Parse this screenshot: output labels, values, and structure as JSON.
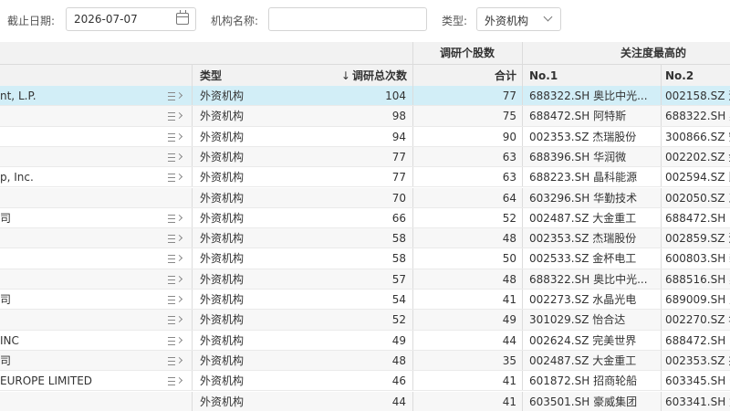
{
  "filters": {
    "date_label": "截止日期:",
    "date_value": "2026-07-07",
    "org_label": "机构名称:",
    "org_value": "",
    "type_label": "类型:",
    "type_value": "外资机构"
  },
  "table": {
    "group_headers": {
      "stock_count": "调研个股数",
      "top_attention": "关注度最高的"
    },
    "columns": {
      "type": "类型",
      "total": "调研总次数",
      "total_sort_icon": "↓",
      "sum": "合计",
      "no1": "No.1",
      "no2": "No.2"
    },
    "rows": [
      {
        "name": "nt, L.P.",
        "menu": true,
        "type": "外资机构",
        "total": "104",
        "sum": "77",
        "no1": "688322.SH 奥比中光...",
        "no2": "002158.SZ 汉"
      },
      {
        "name": "",
        "menu": true,
        "type": "外资机构",
        "total": "98",
        "sum": "75",
        "no1": "688472.SH 阿特斯",
        "no2": "688322.SH 奥"
      },
      {
        "name": "",
        "menu": true,
        "type": "外资机构",
        "total": "94",
        "sum": "90",
        "no1": "002353.SZ 杰瑞股份",
        "no2": "300866.SZ 安"
      },
      {
        "name": "",
        "menu": true,
        "type": "外资机构",
        "total": "77",
        "sum": "63",
        "no1": "688396.SH 华润微",
        "no2": "002202.SZ 金"
      },
      {
        "name": "p, Inc.",
        "menu": true,
        "type": "外资机构",
        "total": "77",
        "sum": "63",
        "no1": "688223.SH 晶科能源",
        "no2": "002594.SZ 比"
      },
      {
        "name": "",
        "menu": false,
        "type": "外资机构",
        "total": "70",
        "sum": "64",
        "no1": "603296.SH 华勤技术",
        "no2": "002050.SZ 三"
      },
      {
        "name": "司",
        "menu": true,
        "type": "外资机构",
        "total": "66",
        "sum": "52",
        "no1": "002487.SZ 大金重工",
        "no2": "688472.SH 阿"
      },
      {
        "name": "",
        "menu": true,
        "type": "外资机构",
        "total": "58",
        "sum": "48",
        "no1": "002353.SZ 杰瑞股份",
        "no2": "002859.SZ 洁"
      },
      {
        "name": "",
        "menu": true,
        "type": "外资机构",
        "total": "58",
        "sum": "50",
        "no1": "002533.SZ 金杯电工",
        "no2": "600803.SH 新"
      },
      {
        "name": "",
        "menu": true,
        "type": "外资机构",
        "total": "57",
        "sum": "48",
        "no1": "688322.SH 奥比中光...",
        "no2": "688516.SH 奥"
      },
      {
        "name": "司",
        "menu": true,
        "type": "外资机构",
        "total": "54",
        "sum": "41",
        "no1": "002273.SZ 水晶光电",
        "no2": "689009.SH 九"
      },
      {
        "name": "",
        "menu": true,
        "type": "外资机构",
        "total": "52",
        "sum": "49",
        "no1": "301029.SZ 怡合达",
        "no2": "002270.SZ 华"
      },
      {
        "name": "INC",
        "menu": true,
        "type": "外资机构",
        "total": "49",
        "sum": "44",
        "no1": "002624.SZ 完美世界",
        "no2": "688472.SH 阿"
      },
      {
        "name": "司",
        "menu": true,
        "type": "外资机构",
        "total": "48",
        "sum": "35",
        "no1": "002487.SZ 大金重工",
        "no2": "002353.SZ 杰"
      },
      {
        "name": "EUROPE LIMITED",
        "menu": true,
        "type": "外资机构",
        "total": "46",
        "sum": "41",
        "no1": "601872.SH 招商轮船",
        "no2": "603345.SH 安"
      },
      {
        "name": "",
        "menu": false,
        "type": "外资机构",
        "total": "44",
        "sum": "41",
        "no1": "603501.SH 豪威集团",
        "no2": "603341.SH 龙"
      }
    ]
  }
}
